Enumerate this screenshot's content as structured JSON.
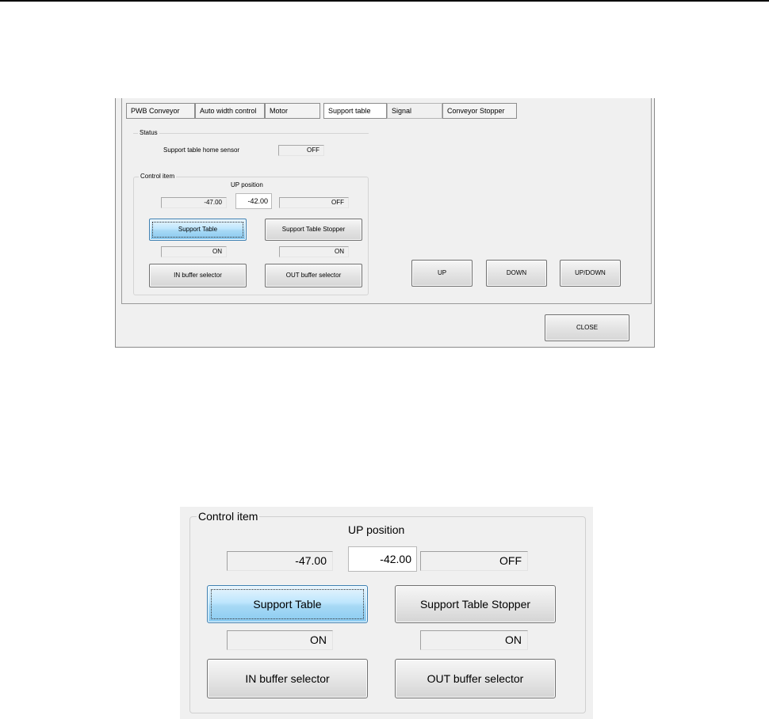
{
  "tabs": [
    {
      "label": "PWB Conveyor"
    },
    {
      "label": "Auto width control"
    },
    {
      "label": "Motor"
    },
    {
      "label": "Support table",
      "active": true
    },
    {
      "label": "Signal"
    },
    {
      "label": "Conveyor Stopper"
    }
  ],
  "status": {
    "group_label": "Status",
    "sensor_label": "Support table home sensor",
    "sensor_value": "OFF"
  },
  "control": {
    "group_label": "Control item",
    "up_position_label": "UP position",
    "left_value": "-47.00",
    "up_position_value": "-42.00",
    "right_value": "OFF",
    "support_table_button": "Support Table",
    "support_table_stopper_button": "Support Table Stopper",
    "support_table_state": "ON",
    "support_table_stopper_state": "ON",
    "in_buffer_button": "IN buffer selector",
    "out_buffer_button": "OUT buffer selector"
  },
  "motion": {
    "up": "UP",
    "down": "DOWN",
    "updown": "UP/DOWN"
  },
  "close_button": "CLOSE",
  "colors": {
    "window_bg": "#f0f0f0",
    "selected_button": "#bee6fd",
    "selected_border": "#3c7fb1"
  }
}
